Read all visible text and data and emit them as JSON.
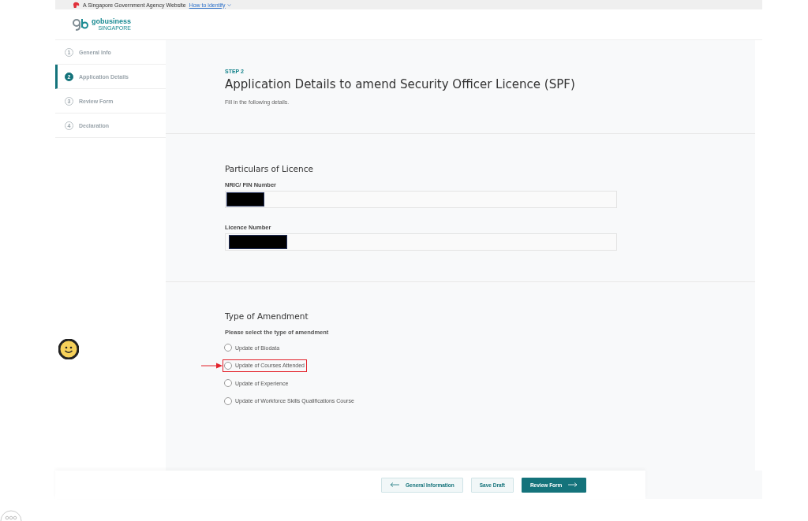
{
  "gov_banner": {
    "text": "A Singapore Government Agency Website",
    "link": "How to identify"
  },
  "logo": {
    "name": "gobusiness",
    "sub": "SINGAPORE"
  },
  "steps": [
    {
      "number": "1",
      "label": "General Info",
      "selected": false
    },
    {
      "number": "2",
      "label": "Application Details",
      "selected": true
    },
    {
      "number": "3",
      "label": "Review Form",
      "selected": false
    },
    {
      "number": "4",
      "label": "Declaration",
      "selected": false
    }
  ],
  "intro": {
    "step": "STEP 2",
    "title": "Application Details to amend Security Officer Licence (SPF)",
    "subtitle": "Fill in the following details."
  },
  "particulars": {
    "heading": "Particulars of Licence",
    "fields": [
      {
        "label": "NRIC/ FIN Number",
        "redacted": true
      },
      {
        "label": "Licence Number",
        "redacted": true
      }
    ]
  },
  "amendment": {
    "heading": "Type of Amendment",
    "prompt": "Please select the type of amendment",
    "options": [
      {
        "label": "Update of Biodata",
        "selected": false,
        "highlighted": false
      },
      {
        "label": "Update of Courses Attended",
        "selected": false,
        "highlighted": true
      },
      {
        "label": "Update of Experience",
        "selected": false,
        "highlighted": false
      },
      {
        "label": "Update of Workforce Skills Qualifications Course",
        "selected": false,
        "highlighted": false
      }
    ]
  },
  "footer": {
    "buttons": [
      {
        "label": "General Information",
        "kind": "back"
      },
      {
        "label": "Save Draft",
        "kind": "plain"
      },
      {
        "label": "Review Form",
        "kind": "next"
      }
    ]
  }
}
